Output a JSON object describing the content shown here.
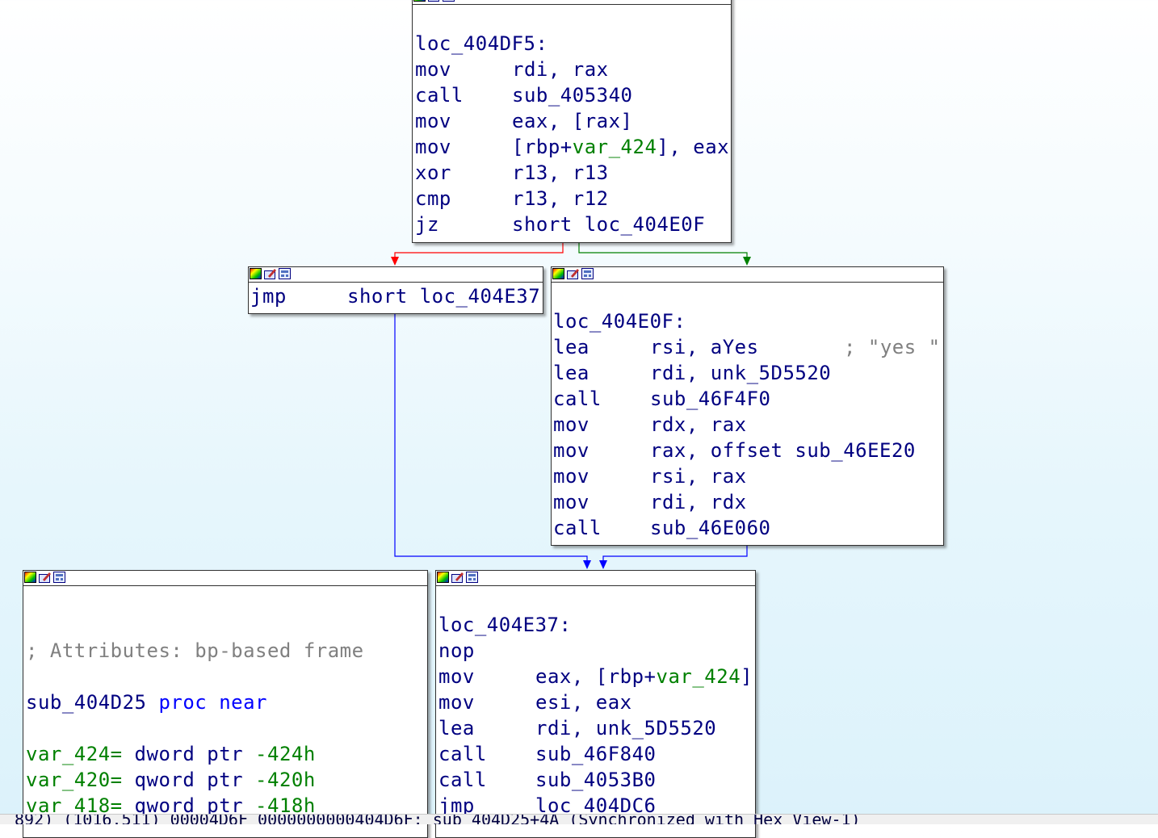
{
  "colors": {
    "false_edge": "#ff0000",
    "true_edge": "#008000",
    "jump_edge": "#0000ff",
    "text": "#000080",
    "variable": "#008000",
    "keyword": "#0000ff",
    "comment": "#808080"
  },
  "header_icons": [
    "color-palette-icon",
    "edit-block-icon",
    "graph-overview-icon"
  ],
  "nodes": {
    "loc_404DF5": {
      "label": "loc_404DF5:",
      "instructions": [
        {
          "mnemonic": "mov",
          "operands": "rdi, rax"
        },
        {
          "mnemonic": "call",
          "operands": "sub_405340"
        },
        {
          "mnemonic": "mov",
          "operands": "eax, [rax]"
        },
        {
          "mnemonic": "mov",
          "op_pre": "[rbp+",
          "op_var": "var_424",
          "op_post": "], eax"
        },
        {
          "mnemonic": "xor",
          "operands": "r13, r13"
        },
        {
          "mnemonic": "cmp",
          "operands": "r13, r12"
        },
        {
          "mnemonic": "jz",
          "operands": "short loc_404E0F"
        }
      ]
    },
    "jmp_block": {
      "instructions": [
        {
          "mnemonic": "jmp",
          "operands": "short loc_404E37"
        }
      ]
    },
    "loc_404E0F": {
      "label": "loc_404E0F:",
      "instructions": [
        {
          "mnemonic": "lea",
          "operands": "rsi, aYes",
          "comment": "; \"yes \""
        },
        {
          "mnemonic": "lea",
          "operands": "rdi, unk_5D5520"
        },
        {
          "mnemonic": "call",
          "operands": "sub_46F4F0"
        },
        {
          "mnemonic": "mov",
          "operands": "rdx, rax"
        },
        {
          "mnemonic": "mov",
          "operands": "rax, offset sub_46EE20"
        },
        {
          "mnemonic": "mov",
          "operands": "rsi, rax"
        },
        {
          "mnemonic": "mov",
          "operands": "rdi, rdx"
        },
        {
          "mnemonic": "call",
          "operands": "sub_46E060"
        }
      ]
    },
    "sub_404D25": {
      "comment": "; Attributes: bp-based frame",
      "proc_name": "sub_404D25",
      "proc_kw": "proc near",
      "vars": [
        {
          "name": "var_424=",
          "type": " dword ptr ",
          "value": "-424h"
        },
        {
          "name": "var_420=",
          "type": " qword ptr ",
          "value": "-420h"
        },
        {
          "name": "var_418=",
          "type": " qword ptr ",
          "value": "-418h"
        }
      ]
    },
    "loc_404E37": {
      "label": "loc_404E37:",
      "instructions": [
        {
          "mnemonic": "nop",
          "operands": ""
        },
        {
          "mnemonic": "mov",
          "op_pre": "eax, [rbp+",
          "op_var": "var_424",
          "op_post": "]"
        },
        {
          "mnemonic": "mov",
          "operands": "esi, eax"
        },
        {
          "mnemonic": "lea",
          "operands": "rdi, unk_5D5520"
        },
        {
          "mnemonic": "call",
          "operands": "sub_46F840"
        },
        {
          "mnemonic": "call",
          "operands": "sub_4053B0"
        },
        {
          "mnemonic": "jmp",
          "operands": "loc_404DC6"
        }
      ]
    }
  },
  "status_bar": {
    "text": "892) (1016,511) 00004D6F 0000000000404D6F: sub_404D25+4A (Synchronized with Hex View-1)"
  }
}
